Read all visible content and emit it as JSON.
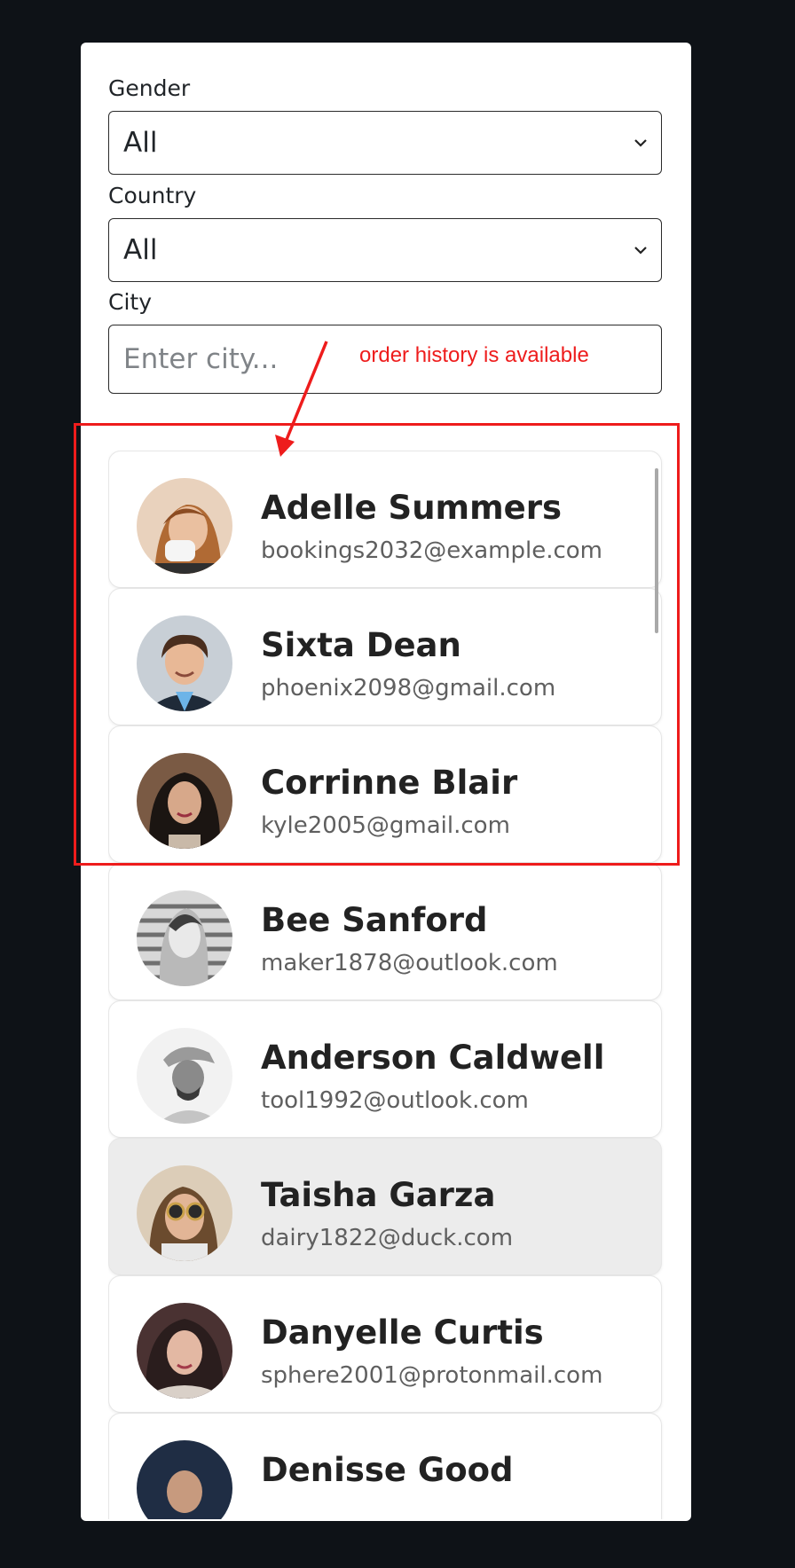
{
  "filters": {
    "gender": {
      "label": "Gender",
      "value": "All"
    },
    "country": {
      "label": "Country",
      "value": "All"
    },
    "city": {
      "label": "City",
      "placeholder": "Enter city..."
    }
  },
  "contacts": [
    {
      "name": "Adelle Summers",
      "email": "bookings2032@example.com",
      "avatar": "avatar-woman-drinking-coffee",
      "selected": false
    },
    {
      "name": "Sixta Dean",
      "email": "phoenix2098@gmail.com",
      "avatar": "avatar-man-smiling",
      "selected": false
    },
    {
      "name": "Corrinne Blair",
      "email": "kyle2005@gmail.com",
      "avatar": "avatar-woman-dark-hair",
      "selected": false
    },
    {
      "name": "Bee Sanford",
      "email": "maker1878@outlook.com",
      "avatar": "avatar-woman-monochrome",
      "selected": false
    },
    {
      "name": "Anderson Caldwell",
      "email": "tool1992@outlook.com",
      "avatar": "avatar-man-cap",
      "selected": false
    },
    {
      "name": "Taisha Garza",
      "email": "dairy1822@duck.com",
      "avatar": "avatar-woman-sunglasses",
      "selected": true
    },
    {
      "name": "Danyelle Curtis",
      "email": "sphere2001@protonmail.com",
      "avatar": "avatar-woman-headscarf",
      "selected": false
    },
    {
      "name": "Denisse Good",
      "email": "",
      "avatar": "avatar-woman-partial",
      "selected": false
    }
  ],
  "annotation": {
    "text": "order history is available",
    "color": "#ee1c1c"
  },
  "colors": {
    "page_background": "#0e1217",
    "panel_background": "#ffffff",
    "selected_card": "#ececec"
  }
}
